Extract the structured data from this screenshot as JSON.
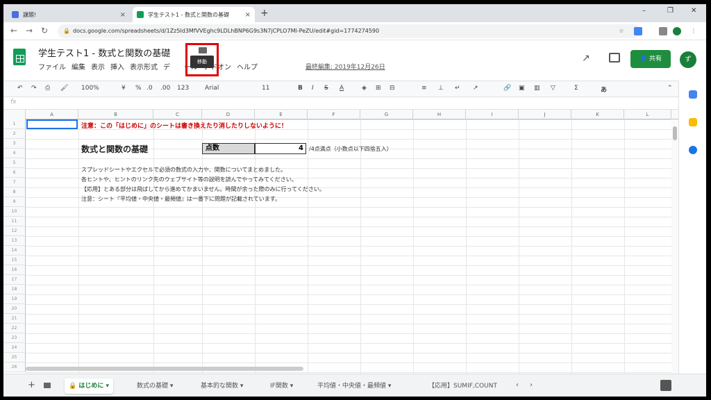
{
  "browser": {
    "tabs": [
      {
        "title": "課題!",
        "close": "×"
      },
      {
        "title": "学生テスト1 - 数式と関数の基礎",
        "close": "×"
      }
    ],
    "new_tab": "+",
    "window_controls": [
      "–",
      "❐",
      "✕"
    ],
    "url": "docs.google.com/spreadsheets/d/1Zz5ld3MfVVEghc9LDLhBNP6G9s3N7jCPLO7Ml-PeZU/edit#gid=1774274590"
  },
  "doc": {
    "title": "学生テスト1 - 数式と関数の基礎",
    "menus": [
      "ファイル",
      "編集",
      "表示",
      "挿入",
      "表示形式",
      "デ",
      "ール",
      "アドオン",
      "ヘルプ"
    ],
    "last_edit": "最終編集: 2019年12月26日",
    "tooltip": "移動",
    "share_label": "共有",
    "avatar_letter": "ず"
  },
  "toolbar": {
    "zoom": "100%",
    "currency": "¥",
    "percent": "%",
    "dec_minus": ".0",
    "dec_plus": ".00",
    "format": "123",
    "font": "Arial",
    "size": "11",
    "bold": "B",
    "italic": "I",
    "strike": "S",
    "textcolor": "A",
    "sigma": "Σ",
    "input": "あ"
  },
  "fx": "fx",
  "grid": {
    "columns": [
      "A",
      "B",
      "C",
      "D",
      "E",
      "F",
      "G",
      "H",
      "I",
      "J",
      "K",
      "L"
    ],
    "rows": [
      "1",
      "2",
      "3",
      "4",
      "5",
      "6",
      "7",
      "8",
      "9",
      "10",
      "11",
      "12",
      "13",
      "14",
      "15",
      "16",
      "17",
      "18",
      "19",
      "20",
      "21",
      "22",
      "23",
      "24",
      "25",
      "26"
    ],
    "notice": "注意：この「はじめに」のシートは書き換えたり消したりしないように！",
    "heading": "数式と関数の基礎",
    "score_label": "点数",
    "score_value": "4",
    "score_note": "/4点満点（小数点以下四捨五入）",
    "body_lines": [
      "スプレッドシートやエクセルで必須の数式の入力や、関数についてまとめました。",
      "各ヒントや、ヒントのリンク先のウェブサイト等の説明を読んでやってみてください。",
      "【応用】とある部分は飛ばしてから進めてかまいません。時間が余った際のみに行ってください。",
      "注意：シート『平均値・中央値・最頻値』は一番下に問題が記載されています。"
    ]
  },
  "sheet_tabs": [
    {
      "label": "はじめに ▾",
      "active": true
    },
    {
      "label": "数式の基礎 ▾",
      "active": false
    },
    {
      "label": "基本的な関数 ▾",
      "active": false
    },
    {
      "label": "IF関数 ▾",
      "active": false
    },
    {
      "label": "平均値・中央値・最頻値 ▾",
      "active": false
    },
    {
      "label": "【応用】SUMIF,COUNT",
      "active": false
    }
  ],
  "colors": {
    "accent_green": "#1e8e3e",
    "highlight_red": "#e00000",
    "notice_red": "#cc0000"
  }
}
